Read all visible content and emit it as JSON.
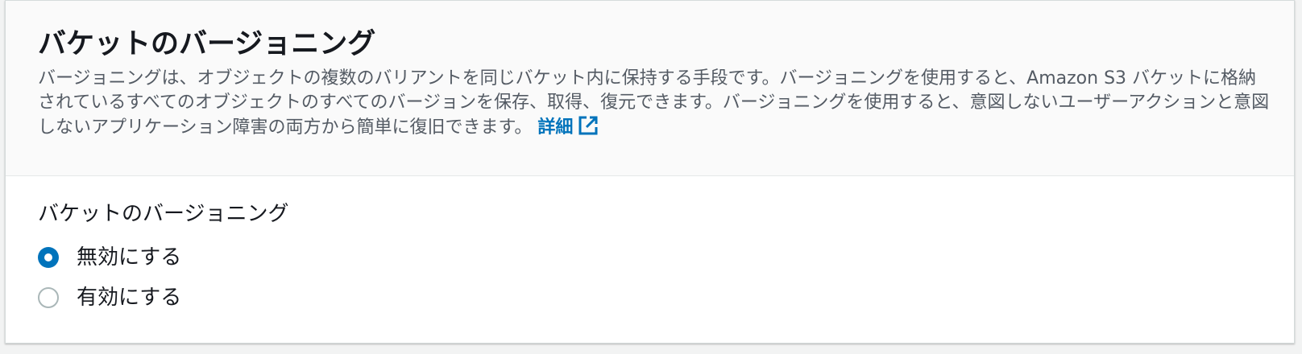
{
  "section": {
    "title": "バケットのバージョニング",
    "description": "バージョニングは、オブジェクトの複数のバリアントを同じバケット内に保持する手段です。バージョニングを使用すると、Amazon S3 バケットに格納されているすべてのオブジェクトのすべてのバージョンを保存、取得、復元できます。バージョニングを使用すると、意図しないユーザーアクションと意図しないアプリケーション障害の両方から簡単に復旧できます。",
    "info_link": "詳細",
    "info_link_icon": "external-link-icon"
  },
  "field": {
    "label": "バケットのバージョニング",
    "options": [
      {
        "label": "無効にする",
        "selected": true
      },
      {
        "label": "有効にする",
        "selected": false
      }
    ]
  },
  "colors": {
    "accent": "#0073bb",
    "text": "#16191f",
    "secondary_text": "#545b64",
    "radio_border": "#aab7b8"
  }
}
